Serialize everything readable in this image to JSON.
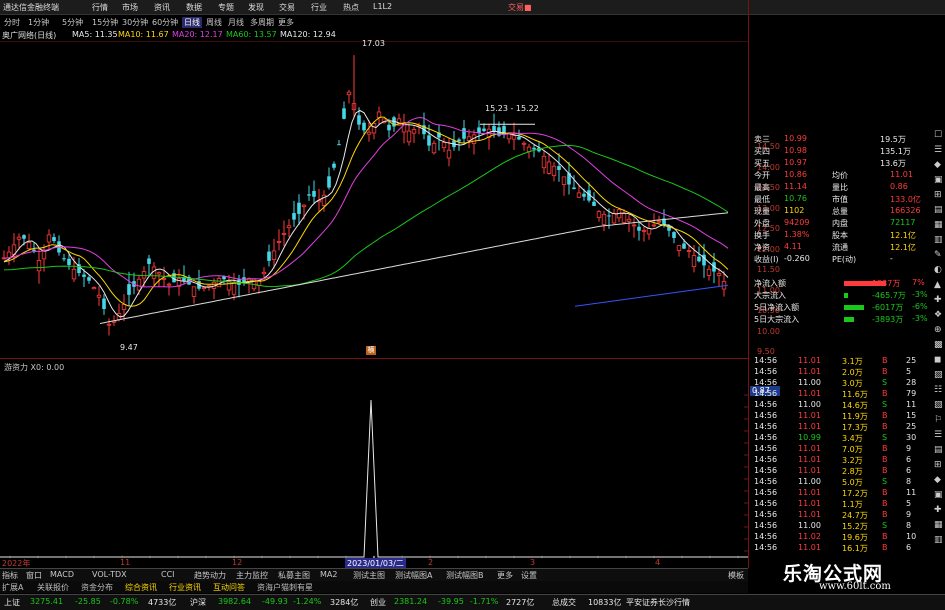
{
  "menubar": {
    "title": "通达信金融终端",
    "items": [
      "行情",
      "市场",
      "资讯",
      "数据",
      "专题",
      "发现",
      "交易",
      "行业",
      "热点",
      "L1L2"
    ],
    "right": "交易■"
  },
  "periods": {
    "items": [
      "分时",
      "1分钟",
      "5分钟",
      "15分钟",
      "30分钟",
      "60分钟",
      "日线",
      "周线",
      "月线",
      "多周期",
      "更多"
    ],
    "active_index": 6
  },
  "ma_legend": {
    "stock": "奥广网络(日线)",
    "ma5": "MA5: 11.35",
    "ma10": "MA10: 11.67",
    "ma20": "MA20: 12.17",
    "ma60": "MA60: 13.57",
    "ma120": "MA120: 12.94"
  },
  "chart_labels": {
    "high": "17.03",
    "range": "15.23 - 15.22",
    "low": "9.47",
    "marker": "横",
    "low_marker": "■"
  },
  "price_axis": [
    "14.50",
    "14.00",
    "13.50",
    "13.00",
    "12.50",
    "12.00",
    "11.50",
    "11.00",
    "10.50",
    "10.00",
    "9.50"
  ],
  "indicator": {
    "title": "游资力 X0: 0.00",
    "value_box": "0.87"
  },
  "date_axis": {
    "start": "2022年",
    "marks": [
      "11",
      "12",
      "2",
      "3",
      "4"
    ],
    "cursor_date": "2023/01/03/二"
  },
  "quote": {
    "rows": [
      {
        "l": "卖三",
        "v1": "10.99",
        "v2": "19.5万"
      },
      {
        "l": "买四",
        "v1": "10.98",
        "v2": "135.1万"
      },
      {
        "l": "买五",
        "v1": "10.97",
        "v2": "13.6万"
      },
      {
        "l": "今开",
        "v1": "10.86",
        "l2": "均价",
        "v2": "11.01"
      },
      {
        "l": "最高",
        "v1": "11.14",
        "l2": "量比",
        "v2": "0.86"
      },
      {
        "l": "最低",
        "v1": "10.76",
        "l2": "市值",
        "v2": "133.0亿"
      },
      {
        "l": "现量",
        "v1": "1102",
        "l2": "总量",
        "v2": "166326"
      },
      {
        "l": "外盘",
        "v1": "94209",
        "l2": "内盘",
        "v2": "72117"
      },
      {
        "l": "换手",
        "v1": "1.38%",
        "l2": "股本",
        "v2": "12.1亿"
      },
      {
        "l": "净资",
        "v1": "4.11",
        "l2": "流通",
        "v2": "12.1亿"
      },
      {
        "l": "收益(I)",
        "v1": "-0.260",
        "l2": "PE(动)",
        "v2": "-"
      }
    ]
  },
  "flow": {
    "rows": [
      {
        "l": "净流入额",
        "v": "1237万",
        "p": "7%"
      },
      {
        "l": "大宗流入",
        "v": "-465.7万",
        "p": "-3%"
      },
      {
        "l": "5日净流入额",
        "v": "-6017万",
        "p": "-6%"
      },
      {
        "l": "5日大宗流入",
        "v": "-3893万",
        "p": "-3%"
      }
    ]
  },
  "trades": [
    {
      "t": "14:56",
      "p": "11.01",
      "v": "3.1万",
      "d": "B",
      "n": "25"
    },
    {
      "t": "14:56",
      "p": "11.01",
      "v": "2.0万",
      "d": "B",
      "n": "5"
    },
    {
      "t": "14:56",
      "p": "11.00",
      "v": "3.0万",
      "d": "S",
      "n": "28"
    },
    {
      "t": "14:56",
      "p": "11.01",
      "v": "11.6万",
      "d": "B",
      "n": "79"
    },
    {
      "t": "14:56",
      "p": "11.00",
      "v": "14.6万",
      "d": "S",
      "n": "11"
    },
    {
      "t": "14:56",
      "p": "11.01",
      "v": "11.9万",
      "d": "B",
      "n": "15"
    },
    {
      "t": "14:56",
      "p": "11.01",
      "v": "17.3万",
      "d": "B",
      "n": "25"
    },
    {
      "t": "14:56",
      "p": "10.99",
      "v": "3.4万",
      "d": "S",
      "n": "30"
    },
    {
      "t": "14:56",
      "p": "11.01",
      "v": "7.0万",
      "d": "B",
      "n": "9"
    },
    {
      "t": "14:56",
      "p": "11.01",
      "v": "3.2万",
      "d": "B",
      "n": "6"
    },
    {
      "t": "14:56",
      "p": "11.01",
      "v": "2.8万",
      "d": "B",
      "n": "6"
    },
    {
      "t": "14:56",
      "p": "11.00",
      "v": "5.0万",
      "d": "S",
      "n": "8"
    },
    {
      "t": "14:56",
      "p": "11.01",
      "v": "17.2万",
      "d": "B",
      "n": "11"
    },
    {
      "t": "14:56",
      "p": "11.01",
      "v": "1.1万",
      "d": "B",
      "n": "5"
    },
    {
      "t": "14:56",
      "p": "11.01",
      "v": "24.7万",
      "d": "B",
      "n": "9"
    },
    {
      "t": "14:56",
      "p": "11.00",
      "v": "15.2万",
      "d": "S",
      "n": "8"
    },
    {
      "t": "14:56",
      "p": "11.02",
      "v": "19.6万",
      "d": "B",
      "n": "10"
    },
    {
      "t": "14:56",
      "p": "11.01",
      "v": "16.1万",
      "d": "B",
      "n": "6"
    }
  ],
  "bottom_tabs": [
    "指标",
    "窗口",
    "MACD",
    "VOL-TDX",
    "CCI",
    "趋势动力",
    "主力监控",
    "私募主图",
    "MA2",
    "测试主图",
    "测试幅图A",
    "测试幅图B",
    "更多",
    "设置"
  ],
  "bottom_tabs2": [
    "扩展A",
    "关联报价",
    "资金分布",
    "综合资讯",
    "行业资讯",
    "互动问答",
    "资海户猫刺有星"
  ],
  "bottom_right": "模板",
  "status": {
    "sh_label": "上证",
    "sh_val": "3275.41",
    "sh_chg": "-25.85",
    "sh_pct": "-0.78%",
    "sh_amt": "4733亿",
    "sz_label": "沪深",
    "sz_val": "3982.64",
    "sz_chg": "-49.93",
    "sz_pct": "-1.24%",
    "sz_amt": "3284亿",
    "cy_label": "创业",
    "cy_val": "2381.24",
    "cy_chg": "-39.95",
    "cy_pct": "-1.71%",
    "cy_amt": "2727亿",
    "total_label": "总成交",
    "total_val": "10833亿",
    "news": "平安证券长沙行情"
  },
  "watermark": {
    "cn": "乐淘公式网",
    "url": "www.60lt.com"
  },
  "sidebar_icons": [
    "☐",
    "☰",
    "◆",
    "▣",
    "⊞",
    "▤",
    "▦",
    "▥",
    "✎",
    "◐",
    "▲",
    "✚",
    "❖",
    "⊕",
    "▩",
    "◼",
    "▨",
    "☷",
    "▧",
    "⚐",
    "☰",
    "▤",
    "⊞",
    "◆",
    "▣",
    "✚",
    "▦",
    "▥"
  ],
  "colors": {
    "up": "#ff3b3b",
    "down": "#19c819",
    "ma5": "#e8e8e8",
    "ma10": "#ffd800",
    "ma20": "#e040e0",
    "ma60": "#19c819",
    "ma120": "#e8e8e8"
  }
}
